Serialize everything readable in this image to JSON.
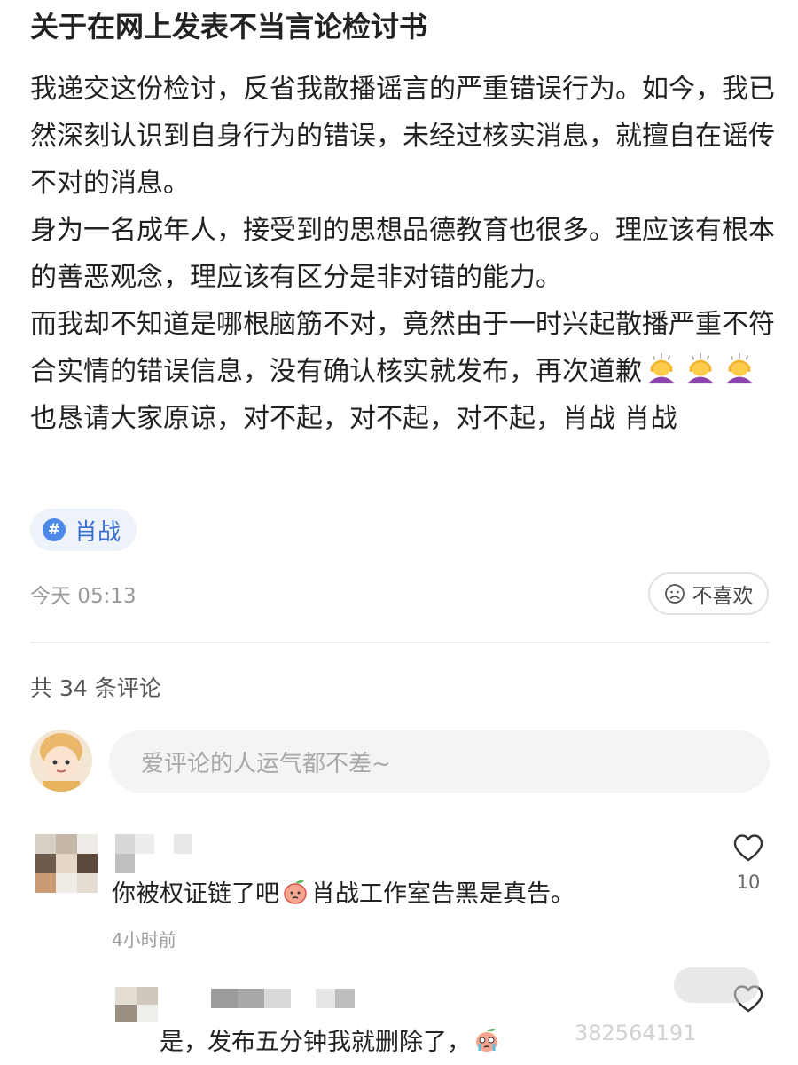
{
  "post": {
    "title": "关于在网上发表不当言论检讨书",
    "paragraphs": [
      "我递交这份检讨，反省我散播谣言的严重错误行为。如今，我已然深刻认识到自身行为的错误，未经过核实消息，就擅自在谣传不对的消息。",
      "身为一名成年人，接受到的思想品德教育也很多。理应该有根本的善恶观念，理应该有区分是非对错的能力。",
      "而我却不知道是哪根脑筋不对，竟然由于一时兴起散播严重不符合实情的错误信息，没有确认核实就发布，再次道歉"
    ],
    "tail_text": "也恳请大家原谅，对不起，对不起，对不起，肖战  肖战",
    "emoji_name": "bowing-person-emoji",
    "emoji_count": 3,
    "tag": {
      "icon": "#",
      "label": "肖战",
      "accent": "#4c89e8"
    },
    "time": "今天 05:13",
    "dislike_label": "不喜欢"
  },
  "comments_section": {
    "count_label": "共 34 条评论",
    "input_placeholder": "爱评论的人运气都不差~"
  },
  "comments": [
    {
      "text_before": "你被权证链了吧",
      "emoji_name": "peach-emoji",
      "text_after": "肖战工作室告黑是真告。",
      "time": "4小时前",
      "likes": "10"
    },
    {
      "text_before": "是，发布五分钟我就删除了，",
      "emoji_name": "crying-face-emoji"
    }
  ],
  "watermark": "382564191"
}
